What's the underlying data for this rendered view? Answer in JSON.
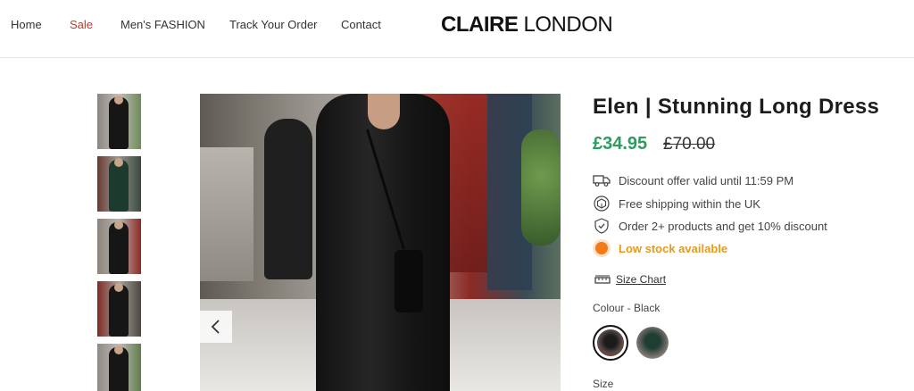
{
  "nav": {
    "items": [
      {
        "label": "Home"
      },
      {
        "label": "Sale"
      },
      {
        "label": "Men's FASHION"
      },
      {
        "label": "Track Your Order"
      },
      {
        "label": "Contact"
      }
    ]
  },
  "logo": {
    "part1": "CLAIRE",
    "part2": "LONDON"
  },
  "gallery": {
    "thumbnails": [
      {
        "icon": "thumbnail-1"
      },
      {
        "icon": "thumbnail-2"
      },
      {
        "icon": "thumbnail-3"
      },
      {
        "icon": "thumbnail-4"
      },
      {
        "icon": "thumbnail-5"
      }
    ],
    "prev_icon": "chevron-left-icon"
  },
  "product": {
    "title": "Elen | Stunning Long Dress",
    "price": "£34.95",
    "old_price": "£70.00",
    "features": [
      {
        "icon": "truck-icon",
        "text": "Discount offer valid until 11:59 PM"
      },
      {
        "icon": "package-icon",
        "text": "Free shipping within the UK"
      },
      {
        "icon": "shield-check-icon",
        "text": "Order 2+ products and get 10% discount"
      },
      {
        "icon": "stock-dot-icon",
        "text": "Low stock available"
      }
    ],
    "size_chart_label": "Size Chart",
    "colour_label": "Colour - Black",
    "size_label": "Size"
  },
  "colors": {
    "price_green": "#2e9b5f",
    "sale_red": "#c0392b",
    "stock_orange": "#e69a1a"
  }
}
